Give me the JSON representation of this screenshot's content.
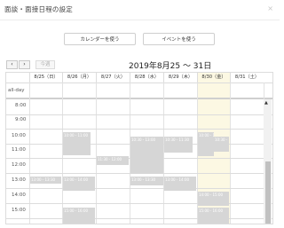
{
  "dialog": {
    "title": "面談・面接日程の設定",
    "close": "×"
  },
  "top_buttons": {
    "calendar_label": "カレンダーを使う",
    "event_label": "イベントを使う"
  },
  "nav": {
    "prev": "‹",
    "next": "›",
    "today": "今週",
    "range_title": "2019年8月25 〜 31日"
  },
  "calendar": {
    "days": [
      "8/25（日）",
      "8/26（月）",
      "8/27（火）",
      "8/28（水）",
      "8/29（木）",
      "8/30（金）",
      "8/31（土）"
    ],
    "today_index": 5,
    "allday_label": "all-day",
    "times": [
      "8:00",
      "9:00",
      "10:00",
      "11:00",
      "12:00",
      "13:00",
      "14:00",
      "15:00"
    ],
    "events": [
      {
        "day": 1,
        "text": "10:00 - 11:00"
      },
      {
        "day": 2,
        "text": "11:30 - 12:00"
      },
      {
        "day": 3,
        "text": "10:30 - 13:00"
      },
      {
        "day": 4,
        "text": "10:30 - 11:30"
      },
      {
        "day": 5,
        "text": "10:00 - 11:00"
      },
      {
        "day": 5,
        "text": "10:30 - 11:30"
      },
      {
        "day": 0,
        "text": "13:00 - 13:30"
      },
      {
        "day": 1,
        "text": "13:00 - 14:00"
      },
      {
        "day": 3,
        "text": "13:00 - 13:30"
      },
      {
        "day": 4,
        "text": "13:00 - 14:00"
      },
      {
        "day": 5,
        "text": "14:00 - 15:00"
      },
      {
        "day": 1,
        "text": "15:00 - 16:00"
      },
      {
        "day": 5,
        "text": "15:00 - 16:00"
      }
    ]
  }
}
